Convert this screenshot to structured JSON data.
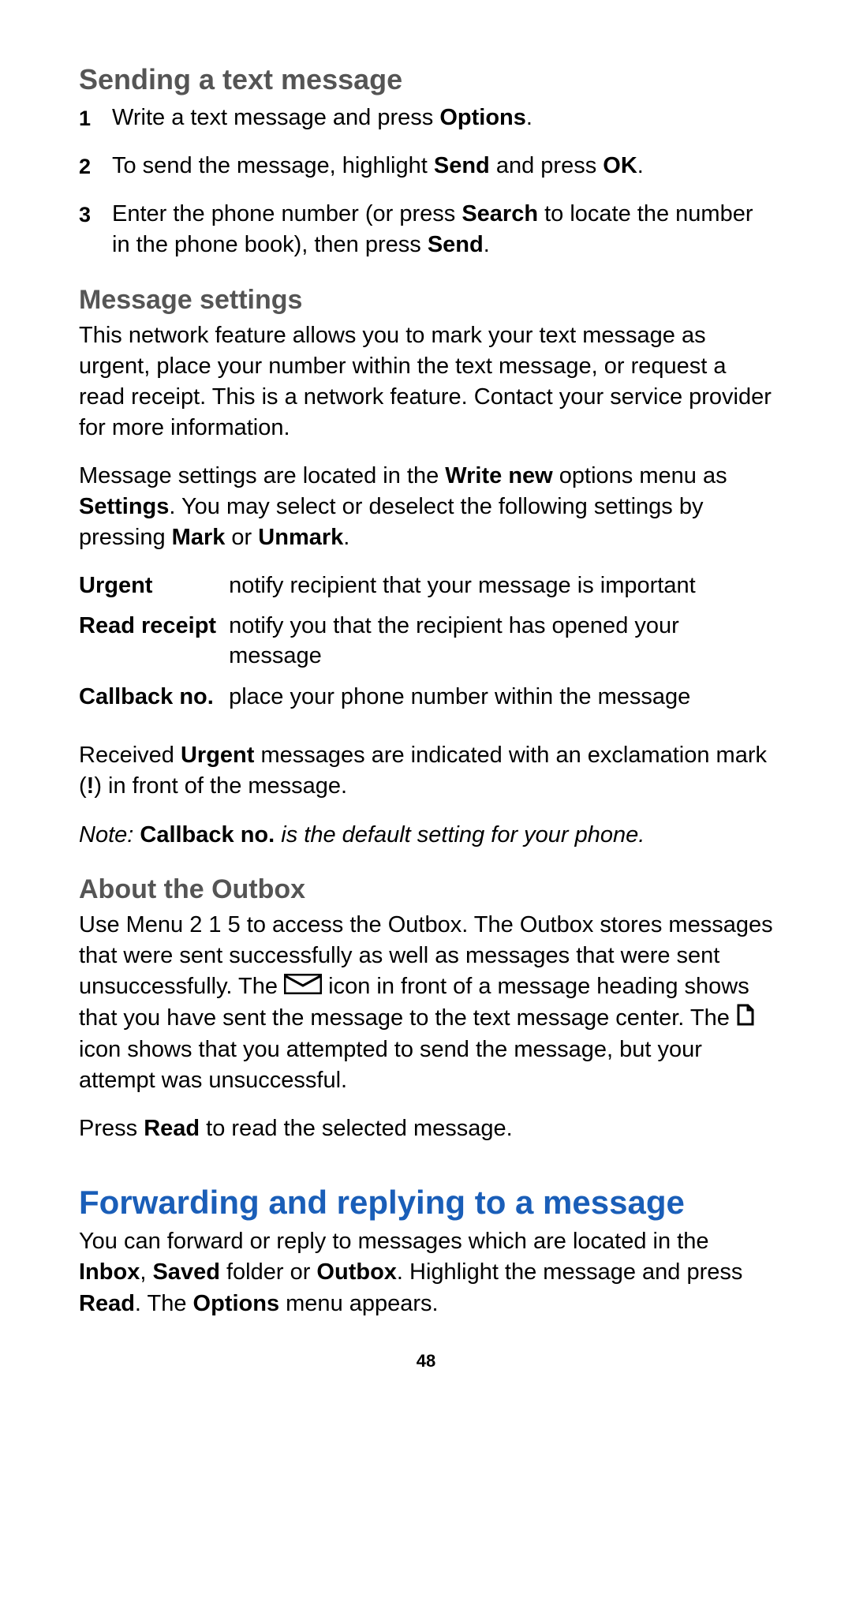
{
  "page_number": "48",
  "sending": {
    "heading": "Sending a text message",
    "steps": [
      {
        "num": "1",
        "pre": "Write a text message and press ",
        "b1": "Options",
        "post": "."
      },
      {
        "num": "2",
        "pre": "To send the message, highlight ",
        "b1": "Send",
        "mid": " and press ",
        "b2": "OK",
        "post": "."
      },
      {
        "num": "3",
        "pre": "Enter the phone number (or press ",
        "b1": "Search",
        "mid": " to locate the number in the phone book), then press ",
        "b2": "Send",
        "post": "."
      }
    ]
  },
  "settings": {
    "heading": "Message settings",
    "intro": "This network feature allows you to mark your text message as urgent, place your number within the text message, or request a read receipt.  This is a network feature. Contact your service provider for more information.",
    "location": {
      "pre": "Message settings are located in the ",
      "b1": "Write new",
      "mid1": " options menu as ",
      "b2": "Settings",
      "mid2": ". You may select or deselect the following settings by pressing ",
      "b3": "Mark",
      "mid3": " or ",
      "b4": "Unmark",
      "post": "."
    },
    "rows": [
      {
        "term": "Urgent",
        "desc": "notify recipient that your message is important"
      },
      {
        "term": "Read receipt",
        "desc": "notify you that the recipient has opened your message"
      },
      {
        "term": "Callback no.",
        "desc": "place your phone number within the message"
      }
    ],
    "urgent_note": {
      "pre": "Received ",
      "b1": "Urgent",
      "mid": " messages are indicated with an exclamation mark (",
      "b2": "!",
      "post": ") in front of the message."
    },
    "note": {
      "label": "Note: ",
      "b1": "Callback no.",
      "rest": " is the default setting for your phone."
    }
  },
  "outbox": {
    "heading": "About the Outbox",
    "body": {
      "pre": "Use Menu 2 1 5 to access the Outbox. The Outbox stores messages that were sent successfully as well as messages that were sent unsuccessfully. The  ",
      "mid1": "  icon in front of a message heading shows that you have sent the message to the text message center. The  ",
      "post": " icon shows that you attempted to send the message, but your attempt was unsuccessful."
    },
    "read": {
      "pre": "Press ",
      "b1": "Read",
      "post": " to read the selected message."
    }
  },
  "forward": {
    "heading": "Forwarding and replying to a message",
    "body": {
      "pre": "You can forward or reply to messages which are located in the ",
      "b1": "Inbox",
      "c1": ", ",
      "b2": "Saved",
      "mid": " folder or ",
      "b3": "Outbox",
      "mid2": ".  Highlight the message and press ",
      "b4": "Read",
      "mid3": ". The ",
      "b5": "Options",
      "post": " menu appears."
    }
  }
}
